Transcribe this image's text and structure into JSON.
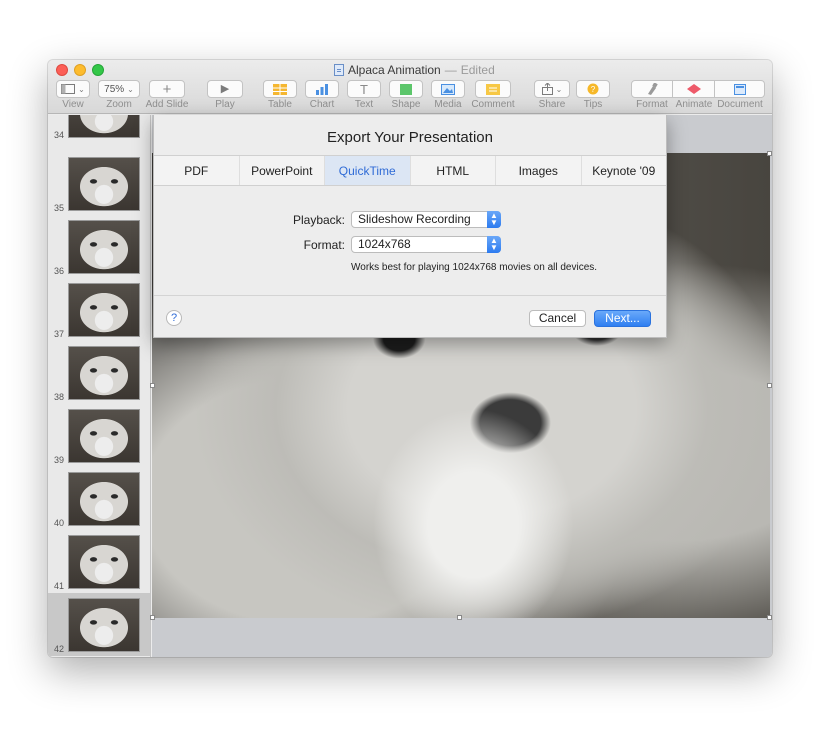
{
  "window": {
    "title": "Alpaca Animation",
    "separator": "—",
    "status": "Edited"
  },
  "toolbar": {
    "view_label": "View",
    "zoom_value": "75%",
    "zoom_label": "Zoom",
    "add_slide_label": "Add Slide",
    "play_label": "Play",
    "table_label": "Table",
    "chart_label": "Chart",
    "text_label": "Text",
    "shape_label": "Shape",
    "media_label": "Media",
    "comment_label": "Comment",
    "share_label": "Share",
    "tips_label": "Tips",
    "format_label": "Format",
    "animate_label": "Animate",
    "document_label": "Document"
  },
  "sidebar": {
    "slides": [
      {
        "number": "34"
      },
      {
        "number": "35"
      },
      {
        "number": "36"
      },
      {
        "number": "37"
      },
      {
        "number": "38"
      },
      {
        "number": "39"
      },
      {
        "number": "40"
      },
      {
        "number": "41"
      },
      {
        "number": "42",
        "selected": true
      }
    ]
  },
  "dialog": {
    "title": "Export Your Presentation",
    "tabs": [
      "PDF",
      "PowerPoint",
      "QuickTime",
      "HTML",
      "Images",
      "Keynote '09"
    ],
    "active_tab": "QuickTime",
    "playback_label": "Playback:",
    "playback_value": "Slideshow Recording",
    "format_label": "Format:",
    "format_value": "1024x768",
    "hint": "Works best for playing 1024x768 movies on all devices.",
    "help": "?",
    "cancel_label": "Cancel",
    "next_label": "Next..."
  },
  "colors": {
    "accent": "#2f7ff1",
    "active_tab_bg": "#dce6f4",
    "close": "#fc5f57",
    "minimize": "#fdbc2e",
    "maximize": "#33c748"
  }
}
